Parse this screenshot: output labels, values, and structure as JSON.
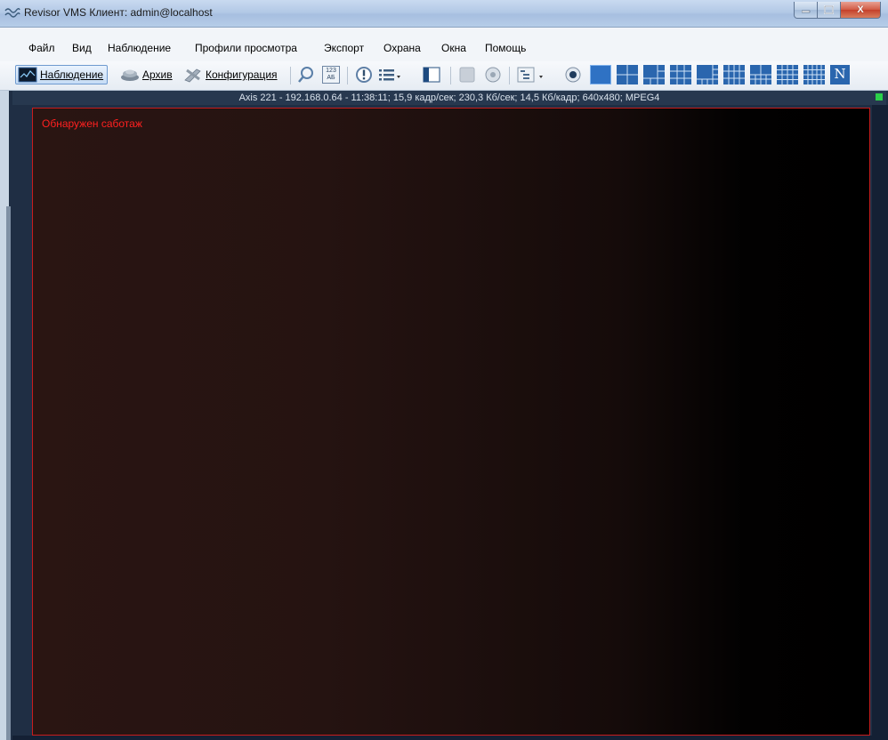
{
  "window": {
    "title": "Revisor VMS Клиент: admin@localhost",
    "icon": "wave-icon"
  },
  "caption": {
    "minimize": "–",
    "maximize": "□",
    "close": "X"
  },
  "menu": [
    "Файл",
    "Вид",
    "Наблюдение",
    "Профили просмотра",
    "Экспорт",
    "Охрана",
    "Окна",
    "Помощь"
  ],
  "toolbar": {
    "observation_label": "Наблюдение",
    "archive_label": "Архив",
    "config_label": "Конфигурация",
    "n_label": "N",
    "ab_label": "123 АБ"
  },
  "camera": {
    "info": "Axis 221 - 192.168.0.64 - 11:38:11; 15,9 кадр/сек; 230,3 Кб/сек; 14,5 Кб/кадр; 640x480; MPEG4",
    "alert": "Обнаружен саботаж"
  },
  "colors": {
    "alert": "#ff2020",
    "frame_border": "#c81d1d",
    "status_led": "#2bd14a"
  }
}
